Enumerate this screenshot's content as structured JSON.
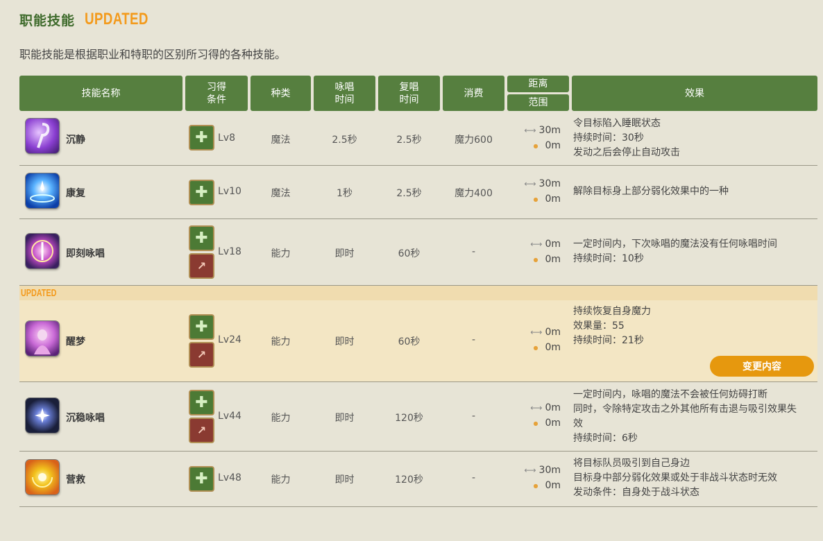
{
  "section": {
    "title": "职能技能",
    "badge": "UPDATED",
    "description": "职能技能是根据职业和特职的区别所习得的各种技能。"
  },
  "columns": {
    "name": "技能名称",
    "learn_1": "习得",
    "learn_2": "条件",
    "type": "种类",
    "cast_1": "咏唱",
    "cast_2": "时间",
    "recast_1": "复唱",
    "recast_2": "时间",
    "cost": "消费",
    "distance": "距离",
    "range": "范围",
    "effect": "效果"
  },
  "rows": [
    {
      "name": "沉静",
      "level": "Lv8",
      "type": "魔法",
      "cast": "2.5秒",
      "recast": "2.5秒",
      "cost": "魔力600",
      "distance": "30m",
      "range": "0m",
      "effect": [
        "令目标陷入睡眠状态",
        "持续时间：30秒",
        "发动之后会停止自动攻击"
      ],
      "job_icons": [
        "healer-job-icon"
      ]
    },
    {
      "name": "康复",
      "level": "Lv10",
      "type": "魔法",
      "cast": "1秒",
      "recast": "2.5秒",
      "cost": "魔力400",
      "distance": "30m",
      "range": "0m",
      "effect": [
        "解除目标身上部分弱化效果中的一种"
      ],
      "job_icons": [
        "healer-job-icon"
      ]
    },
    {
      "name": "即刻咏唱",
      "level": "Lv18",
      "type": "能力",
      "cast": "即时",
      "recast": "60秒",
      "cost": "-",
      "distance": "0m",
      "range": "0m",
      "effect": [
        "一定时间内，下次咏唱的魔法没有任何咏唱时间",
        "持续时间：10秒"
      ],
      "job_icons": [
        "healer-job-icon",
        "caster-job-icon"
      ]
    },
    {
      "name": "醒梦",
      "level": "Lv24",
      "type": "能力",
      "cast": "即时",
      "recast": "60秒",
      "cost": "-",
      "distance": "0m",
      "range": "0m",
      "effect": [
        "持续恢复自身魔力",
        "效果量：55",
        "持续时间：21秒"
      ],
      "job_icons": [
        "healer-job-icon",
        "caster-job-icon"
      ],
      "updated_label": "UPDATED",
      "change_button": "变更内容"
    },
    {
      "name": "沉稳咏唱",
      "level": "Lv44",
      "type": "能力",
      "cast": "即时",
      "recast": "120秒",
      "cost": "-",
      "distance": "0m",
      "range": "0m",
      "effect": [
        "一定时间内，咏唱的魔法不会被任何妨碍打断",
        "同时，令除特定攻击之外其他所有击退与吸引效果失",
        "效",
        "持续时间：6秒"
      ],
      "job_icons": [
        "healer-job-icon",
        "caster-job-icon"
      ]
    },
    {
      "name": "营救",
      "level": "Lv48",
      "type": "能力",
      "cast": "即时",
      "recast": "120秒",
      "cost": "-",
      "distance": "30m",
      "range": "0m",
      "effect": [
        "将目标队员吸引到自己身边",
        "目标身中部分弱化效果或处于非战斗状态时无效",
        "发动条件：自身处于战斗状态"
      ],
      "job_icons": [
        "healer-job-icon"
      ]
    }
  ],
  "colors": {
    "header_green": "#567f3f",
    "accent_orange": "#f39a1c",
    "button_orange": "#e6980e",
    "updated_row": "#f3e6c4"
  }
}
